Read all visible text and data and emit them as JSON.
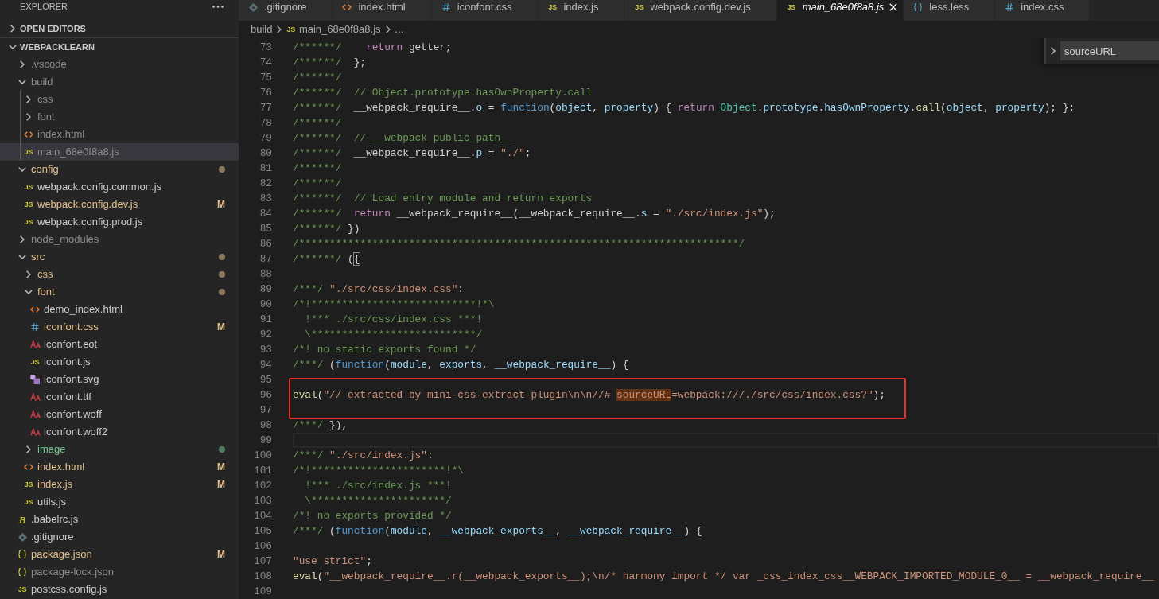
{
  "sidebar": {
    "title": "EXPLORER",
    "sections": [
      {
        "title": "OPEN EDITORS",
        "expanded": false
      },
      {
        "title": "WEBPACKLEARN",
        "expanded": true,
        "items": [
          {
            "name": ".vscode",
            "kind": "folder",
            "expanded": false,
            "color": "#8c8c8c",
            "selected": false,
            "dot": false
          },
          {
            "name": "build",
            "kind": "folder",
            "expanded": true,
            "color": "#8c8c8c",
            "selected": false,
            "dot": false,
            "children": [
              {
                "name": "css",
                "kind": "folder",
                "expanded": false,
                "color": "#8c8c8c",
                "selected": false,
                "dot": false
              },
              {
                "name": "font",
                "kind": "folder",
                "expanded": false,
                "color": "#8c8c8c",
                "selected": false,
                "dot": false
              },
              {
                "name": "index.html",
                "kind": "html",
                "color": "#8c8c8c",
                "selected": false,
                "dot": false
              },
              {
                "name": "main_68e0f8a8.js",
                "kind": "js",
                "glyph": "JS",
                "color": "#8c8c8c",
                "selected": true,
                "dot": false
              }
            ]
          },
          {
            "name": "config",
            "kind": "folder",
            "expanded": true,
            "color": "#e2c08d",
            "selected": false,
            "dot": true,
            "children": [
              {
                "name": "webpack.config.common.js",
                "kind": "js",
                "glyph": "JS",
                "color": "#cccccc",
                "selected": false,
                "dot": false
              },
              {
                "name": "webpack.config.dev.js",
                "kind": "js",
                "glyph": "JS",
                "color": "#e2c08d",
                "badge": "M",
                "selected": false,
                "dot": false
              },
              {
                "name": "webpack.config.prod.js",
                "kind": "js",
                "glyph": "JS",
                "color": "#cccccc",
                "selected": false,
                "dot": false
              }
            ]
          },
          {
            "name": "node_modules",
            "kind": "folder",
            "expanded": false,
            "color": "#8c8c8c",
            "selected": false,
            "dot": false
          },
          {
            "name": "src",
            "kind": "folder",
            "expanded": true,
            "color": "#e2c08d",
            "selected": false,
            "dot": true,
            "children": [
              {
                "name": "css",
                "kind": "folder",
                "expanded": false,
                "color": "#e2c08d",
                "selected": false,
                "dot": true
              },
              {
                "name": "font",
                "kind": "folder",
                "expanded": true,
                "color": "#e2c08d",
                "selected": false,
                "dot": true,
                "children": [
                  {
                    "name": "demo_index.html",
                    "kind": "html",
                    "color": "#cccccc",
                    "selected": false,
                    "dot": false
                  },
                  {
                    "name": "iconfont.css",
                    "kind": "css",
                    "color": "#e2c08d",
                    "badge": "M",
                    "selected": false,
                    "dot": false
                  },
                  {
                    "name": "iconfont.eot",
                    "kind": "font",
                    "color": "#cccccc",
                    "selected": false,
                    "dot": false
                  },
                  {
                    "name": "iconfont.js",
                    "kind": "js",
                    "glyph": "JS",
                    "color": "#cccccc",
                    "selected": false,
                    "dot": false
                  },
                  {
                    "name": "iconfont.svg",
                    "kind": "svg",
                    "color": "#cccccc",
                    "selected": false,
                    "dot": false
                  },
                  {
                    "name": "iconfont.ttf",
                    "kind": "font",
                    "color": "#cccccc",
                    "selected": false,
                    "dot": false
                  },
                  {
                    "name": "iconfont.woff",
                    "kind": "font",
                    "color": "#cccccc",
                    "selected": false,
                    "dot": false
                  },
                  {
                    "name": "iconfont.woff2",
                    "kind": "font",
                    "color": "#cccccc",
                    "selected": false,
                    "dot": false
                  }
                ]
              },
              {
                "name": "image",
                "kind": "folder",
                "expanded": false,
                "color": "#73c991",
                "selected": false,
                "dot": true
              },
              {
                "name": "index.html",
                "kind": "html",
                "color": "#e2c08d",
                "badge": "M",
                "selected": false,
                "dot": false
              },
              {
                "name": "index.js",
                "kind": "js",
                "glyph": "JS",
                "color": "#e2c08d",
                "badge": "M",
                "selected": false,
                "dot": false
              },
              {
                "name": "utils.js",
                "kind": "js",
                "glyph": "JS",
                "color": "#cccccc",
                "selected": false,
                "dot": false
              }
            ]
          },
          {
            "name": ".babelrc.js",
            "kind": "babel",
            "glyph": "B",
            "color": "#cccccc",
            "selected": false,
            "dot": false
          },
          {
            "name": ".gitignore",
            "kind": "gitfile",
            "color": "#cccccc",
            "selected": false,
            "dot": false
          },
          {
            "name": "package.json",
            "kind": "json",
            "color": "#e2c08d",
            "badge": "M",
            "selected": false,
            "dot": false
          },
          {
            "name": "package-lock.json",
            "kind": "json",
            "color": "#8c8c8c",
            "selected": false,
            "dot": false
          },
          {
            "name": "postcss.config.js",
            "kind": "js",
            "glyph": "JS",
            "color": "#cccccc",
            "selected": false,
            "dot": false
          }
        ]
      }
    ]
  },
  "tabs": [
    {
      "label": ".gitignore",
      "kind": "gitfile",
      "selected": false,
      "preview": false
    },
    {
      "label": "index.html",
      "kind": "html",
      "selected": false,
      "preview": false
    },
    {
      "label": "iconfont.css",
      "kind": "css",
      "selected": false,
      "preview": false
    },
    {
      "label": "index.js",
      "kind": "js",
      "glyph": "JS",
      "selected": false,
      "preview": false
    },
    {
      "label": "webpack.config.dev.js",
      "kind": "js",
      "glyph": "JS",
      "selected": false,
      "preview": false
    },
    {
      "label": "main_68e0f8a8.js",
      "kind": "js",
      "glyph": "JS",
      "selected": true,
      "preview": true
    },
    {
      "label": "less.less",
      "kind": "less",
      "selected": false,
      "preview": false
    },
    {
      "label": "index.css",
      "kind": "css",
      "selected": false,
      "preview": false
    }
  ],
  "breadcrumbs": [
    {
      "label": "build",
      "kind": "folder"
    },
    {
      "label": "main_68e0f8a8.js",
      "kind": "js",
      "glyph": "JS"
    },
    {
      "label": "...",
      "kind": "more"
    }
  ],
  "find": {
    "replace_expanded": false,
    "value": "sourceURL"
  },
  "code": {
    "lines": [
      {
        "number": "73",
        "current": false,
        "framed": false,
        "tokens": [
          {
            "kind": "comment",
            "text": "/******/"
          },
          {
            "kind": "keyword",
            "text": "    return"
          },
          {
            "kind": "plain",
            "text": " getter;"
          }
        ]
      },
      {
        "number": "74",
        "current": false,
        "framed": false,
        "tokens": [
          {
            "kind": "comment",
            "text": "/******/"
          },
          {
            "kind": "plain",
            "text": "  };"
          }
        ]
      },
      {
        "number": "75",
        "current": false,
        "framed": false,
        "tokens": [
          {
            "kind": "comment",
            "text": "/******/"
          }
        ]
      },
      {
        "number": "76",
        "current": false,
        "framed": false,
        "tokens": [
          {
            "kind": "comment",
            "text": "/******/  // Object.prototype.hasOwnProperty.call"
          }
        ]
      },
      {
        "number": "77",
        "current": false,
        "framed": false,
        "tokens": [
          {
            "kind": "comment",
            "text": "/******/"
          },
          {
            "kind": "plain",
            "text": "  __webpack_require__."
          },
          {
            "kind": "variable",
            "text": "o"
          },
          {
            "kind": "plain",
            "text": " = "
          },
          {
            "kind": "storage",
            "text": "function"
          },
          {
            "kind": "plain",
            "text": "("
          },
          {
            "kind": "variable",
            "text": "object"
          },
          {
            "kind": "plain",
            "text": ", "
          },
          {
            "kind": "variable",
            "text": "property"
          },
          {
            "kind": "plain",
            "text": ") { "
          },
          {
            "kind": "keyword",
            "text": "return"
          },
          {
            "kind": "type",
            "text": " Object"
          },
          {
            "kind": "plain",
            "text": "."
          },
          {
            "kind": "variable",
            "text": "prototype"
          },
          {
            "kind": "plain",
            "text": "."
          },
          {
            "kind": "variable",
            "text": "hasOwnProperty"
          },
          {
            "kind": "plain",
            "text": "."
          },
          {
            "kind": "func",
            "text": "call"
          },
          {
            "kind": "plain",
            "text": "("
          },
          {
            "kind": "variable",
            "text": "object"
          },
          {
            "kind": "plain",
            "text": ", "
          },
          {
            "kind": "variable",
            "text": "property"
          },
          {
            "kind": "plain",
            "text": "); };"
          }
        ]
      },
      {
        "number": "78",
        "current": false,
        "framed": false,
        "tokens": [
          {
            "kind": "comment",
            "text": "/******/"
          }
        ]
      },
      {
        "number": "79",
        "current": false,
        "framed": false,
        "tokens": [
          {
            "kind": "comment",
            "text": "/******/  // __webpack_public_path__"
          }
        ]
      },
      {
        "number": "80",
        "current": false,
        "framed": false,
        "tokens": [
          {
            "kind": "comment",
            "text": "/******/"
          },
          {
            "kind": "plain",
            "text": "  __webpack_require__."
          },
          {
            "kind": "variable",
            "text": "p"
          },
          {
            "kind": "plain",
            "text": " = "
          },
          {
            "kind": "string",
            "text": "\"./\""
          },
          {
            "kind": "plain",
            "text": ";"
          }
        ]
      },
      {
        "number": "81",
        "current": false,
        "framed": false,
        "tokens": [
          {
            "kind": "comment",
            "text": "/******/"
          }
        ]
      },
      {
        "number": "82",
        "current": false,
        "framed": false,
        "tokens": [
          {
            "kind": "comment",
            "text": "/******/"
          }
        ]
      },
      {
        "number": "83",
        "current": false,
        "framed": false,
        "tokens": [
          {
            "kind": "comment",
            "text": "/******/  // Load entry module and return exports"
          }
        ]
      },
      {
        "number": "84",
        "current": false,
        "framed": false,
        "tokens": [
          {
            "kind": "comment",
            "text": "/******/"
          },
          {
            "kind": "keyword",
            "text": "  return"
          },
          {
            "kind": "plain",
            "text": " __webpack_require__(__webpack_require__."
          },
          {
            "kind": "variable",
            "text": "s"
          },
          {
            "kind": "plain",
            "text": " = "
          },
          {
            "kind": "string",
            "text": "\"./src/index.js\""
          },
          {
            "kind": "plain",
            "text": ");"
          }
        ]
      },
      {
        "number": "85",
        "current": false,
        "framed": false,
        "tokens": [
          {
            "kind": "comment",
            "text": "/******/"
          },
          {
            "kind": "plain",
            "text": " })"
          }
        ]
      },
      {
        "number": "86",
        "current": false,
        "framed": false,
        "tokens": [
          {
            "kind": "comment",
            "text": "/************************************************************************/"
          }
        ]
      },
      {
        "number": "87",
        "current": false,
        "framed": false,
        "tokens": [
          {
            "kind": "comment",
            "text": "/******/"
          },
          {
            "kind": "plain",
            "text": " ("
          },
          {
            "kind": "bracket",
            "text": "{"
          }
        ]
      },
      {
        "number": "88",
        "current": false,
        "framed": false
      },
      {
        "number": "89",
        "current": false,
        "framed": false,
        "tokens": [
          {
            "kind": "comment",
            "text": "/***/"
          },
          {
            "kind": "string",
            "text": " \"./src/css/index.css\""
          },
          {
            "kind": "plain",
            "text": ":"
          }
        ]
      },
      {
        "number": "90",
        "current": false,
        "framed": false,
        "tokens": [
          {
            "kind": "comment",
            "text": "/*!***************************!*\\"
          }
        ]
      },
      {
        "number": "91",
        "current": false,
        "framed": false,
        "tokens": [
          {
            "kind": "comment",
            "text": "  !*** ./src/css/index.css ***!"
          }
        ]
      },
      {
        "number": "92",
        "current": false,
        "framed": false,
        "tokens": [
          {
            "kind": "comment",
            "text": "  \\***************************/"
          }
        ]
      },
      {
        "number": "93",
        "current": false,
        "framed": false,
        "tokens": [
          {
            "kind": "comment",
            "text": "/*! no static exports found */"
          }
        ]
      },
      {
        "number": "94",
        "current": false,
        "framed": false,
        "tokens": [
          {
            "kind": "comment",
            "text": "/***/"
          },
          {
            "kind": "plain",
            "text": " ("
          },
          {
            "kind": "storage",
            "text": "function"
          },
          {
            "kind": "plain",
            "text": "("
          },
          {
            "kind": "variable",
            "text": "module"
          },
          {
            "kind": "plain",
            "text": ", "
          },
          {
            "kind": "variable",
            "text": "exports"
          },
          {
            "kind": "plain",
            "text": ", "
          },
          {
            "kind": "variable",
            "text": "__webpack_require__"
          },
          {
            "kind": "plain",
            "text": ") {"
          }
        ]
      },
      {
        "number": "95",
        "current": false,
        "framed": false
      },
      {
        "number": "96",
        "current": false,
        "framed": true,
        "tokens": [
          {
            "kind": "func",
            "text": "eval"
          },
          {
            "kind": "plain",
            "text": "("
          },
          {
            "kind": "string",
            "text": "\"// extracted by mini-css-extract-plugin\\n\\n//# "
          },
          {
            "kind": "match",
            "text": "sourceURL"
          },
          {
            "kind": "string",
            "text": "=webpack:///./src/css/index.css?\""
          },
          {
            "kind": "plain",
            "text": ");"
          }
        ]
      },
      {
        "number": "97",
        "current": false,
        "framed": true
      },
      {
        "number": "98",
        "current": false,
        "framed": false,
        "tokens": [
          {
            "kind": "comment",
            "text": "/***/"
          },
          {
            "kind": "plain",
            "text": " }),"
          }
        ]
      },
      {
        "number": "99",
        "current": true,
        "framed": false
      },
      {
        "number": "100",
        "current": false,
        "framed": false,
        "tokens": [
          {
            "kind": "comment",
            "text": "/***/"
          },
          {
            "kind": "string",
            "text": " \"./src/index.js\""
          },
          {
            "kind": "plain",
            "text": ":"
          }
        ]
      },
      {
        "number": "101",
        "current": false,
        "framed": false,
        "tokens": [
          {
            "kind": "comment",
            "text": "/*!**********************!*\\"
          }
        ]
      },
      {
        "number": "102",
        "current": false,
        "framed": false,
        "tokens": [
          {
            "kind": "comment",
            "text": "  !*** ./src/index.js ***!"
          }
        ]
      },
      {
        "number": "103",
        "current": false,
        "framed": false,
        "tokens": [
          {
            "kind": "comment",
            "text": "  \\**********************/"
          }
        ]
      },
      {
        "number": "104",
        "current": false,
        "framed": false,
        "tokens": [
          {
            "kind": "comment",
            "text": "/*! no exports provided */"
          }
        ]
      },
      {
        "number": "105",
        "current": false,
        "framed": false,
        "tokens": [
          {
            "kind": "comment",
            "text": "/***/"
          },
          {
            "kind": "plain",
            "text": " ("
          },
          {
            "kind": "storage",
            "text": "function"
          },
          {
            "kind": "plain",
            "text": "("
          },
          {
            "kind": "variable",
            "text": "module"
          },
          {
            "kind": "plain",
            "text": ", "
          },
          {
            "kind": "variable",
            "text": "__webpack_exports__"
          },
          {
            "kind": "plain",
            "text": ", "
          },
          {
            "kind": "variable",
            "text": "__webpack_require__"
          },
          {
            "kind": "plain",
            "text": ") {"
          }
        ]
      },
      {
        "number": "106",
        "current": false,
        "framed": false
      },
      {
        "number": "107",
        "current": false,
        "framed": false,
        "tokens": [
          {
            "kind": "string",
            "text": "\"use strict\""
          },
          {
            "kind": "plain",
            "text": ";"
          }
        ]
      },
      {
        "number": "108",
        "current": false,
        "framed": false,
        "tokens": [
          {
            "kind": "func",
            "text": "eval"
          },
          {
            "kind": "plain",
            "text": "("
          },
          {
            "kind": "string",
            "text": "\"__webpack_require__.r(__webpack_exports__);\\n/* harmony import */ var _css_index_css__WEBPACK_IMPORTED_MODULE_0__ = __webpack_require__"
          }
        ]
      },
      {
        "number": "109",
        "current": false,
        "framed": false
      }
    ]
  }
}
